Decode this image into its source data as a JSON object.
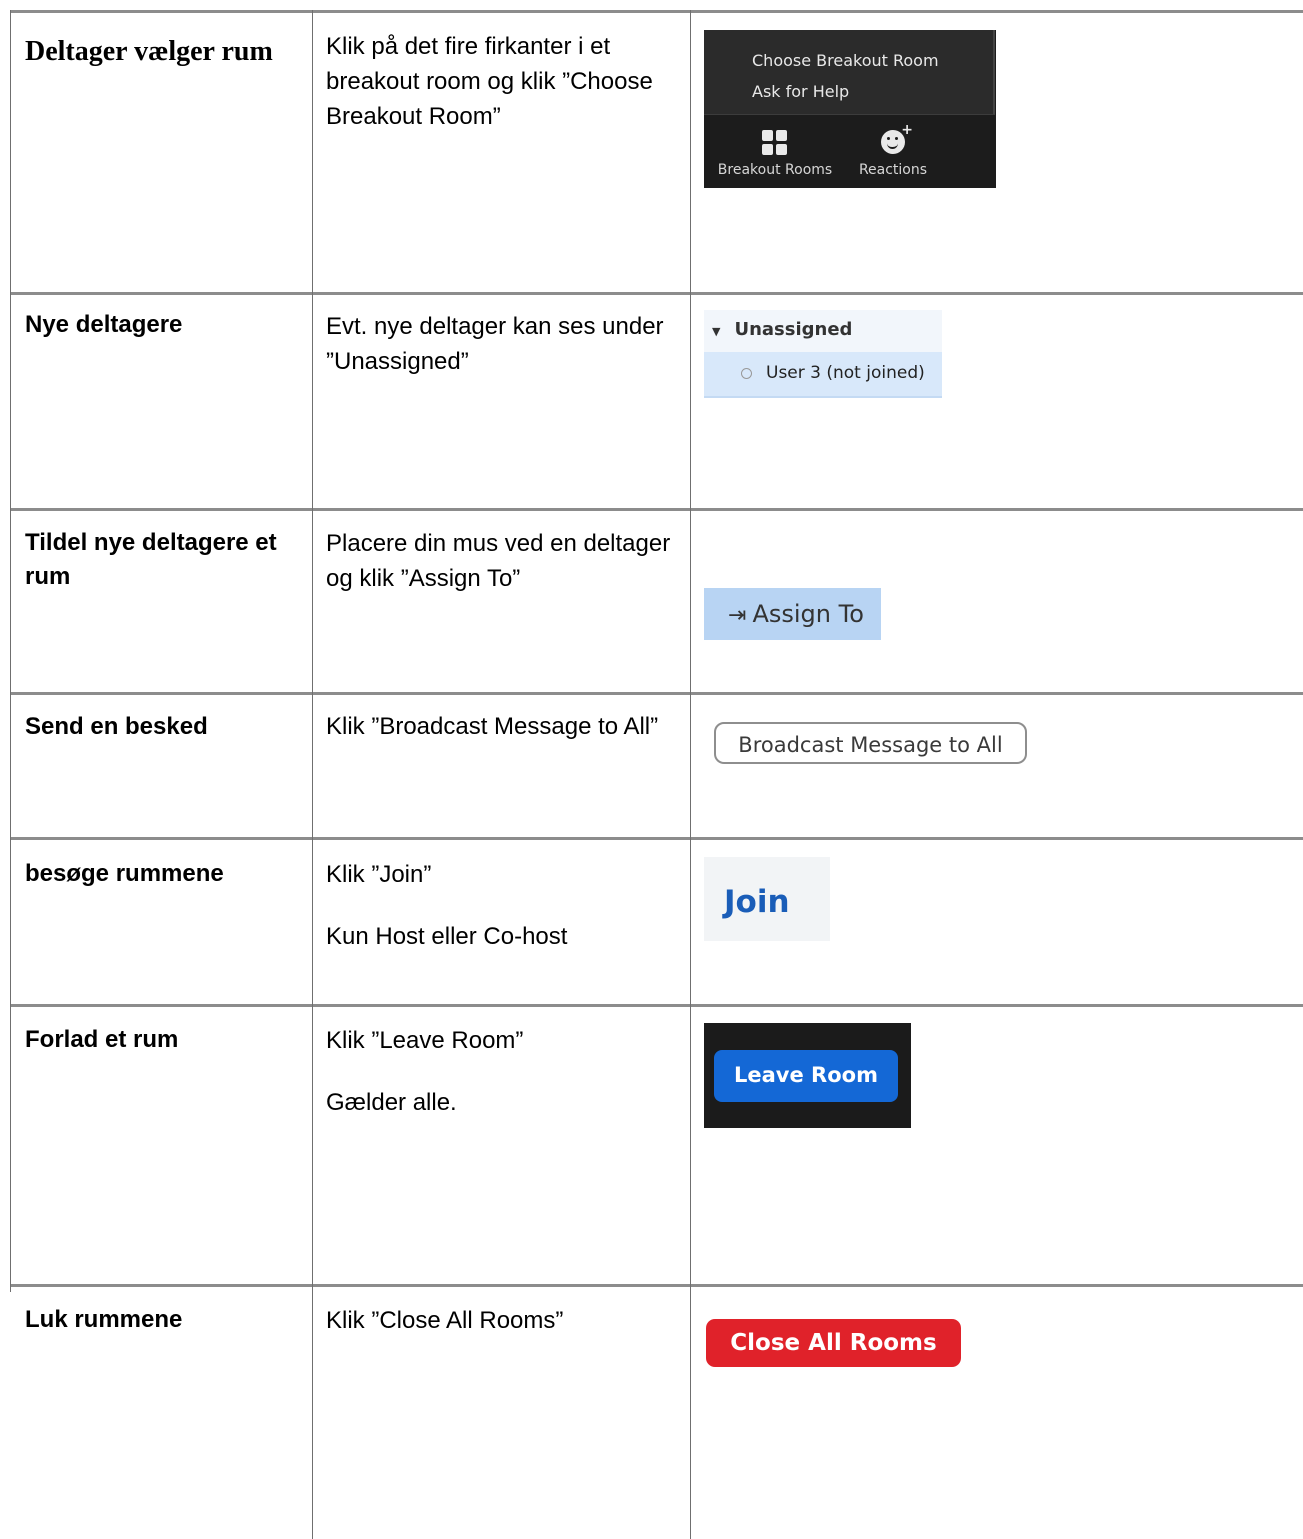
{
  "rows": [
    {
      "title": "Deltager vælger rum",
      "description": [
        "Klik på det fire firkanter i et breakout room og klik ”Choose Breakout Room”"
      ],
      "image": {
        "menu_items": [
          "Choose Breakout Room",
          "Ask for Help"
        ],
        "toolbar": [
          {
            "label": "Breakout Rooms",
            "icon": "grid-icon"
          },
          {
            "label": "Reactions",
            "icon": "reactions-icon"
          }
        ]
      }
    },
    {
      "title": "Nye deltagere",
      "description": [
        "Evt. nye deltager kan ses under ”Unassigned”"
      ],
      "image": {
        "header": "Unassigned",
        "item": "User 3 (not joined)"
      }
    },
    {
      "title": "Tildel nye deltagere et rum",
      "description": [
        "Placere din mus ved en deltager og klik  ”Assign To”"
      ],
      "image": {
        "button": "Assign To",
        "icon": "assign-arrow-icon"
      }
    },
    {
      "title": "Send en besked",
      "description": [
        "Klik ”Broadcast Message to All”"
      ],
      "image": {
        "button": "Broadcast Message to All"
      }
    },
    {
      "title": "besøge rummene",
      "description": [
        "Klik ”Join”",
        "Kun Host eller Co-host"
      ],
      "image": {
        "button": "Join"
      }
    },
    {
      "title": "Forlad et rum",
      "description": [
        "Klik ”Leave Room”",
        "Gælder alle."
      ],
      "image": {
        "button": "Leave Room"
      }
    },
    {
      "title": "Luk rummene",
      "description": [
        "Klik ”Close All Rooms”"
      ],
      "image": {
        "button": "Close All Rooms"
      }
    }
  ],
  "colors": {
    "leave_button": "#1468d6",
    "close_button": "#e0222a",
    "join_text": "#1a5db8",
    "assign_bg": "#b8d4f3"
  }
}
